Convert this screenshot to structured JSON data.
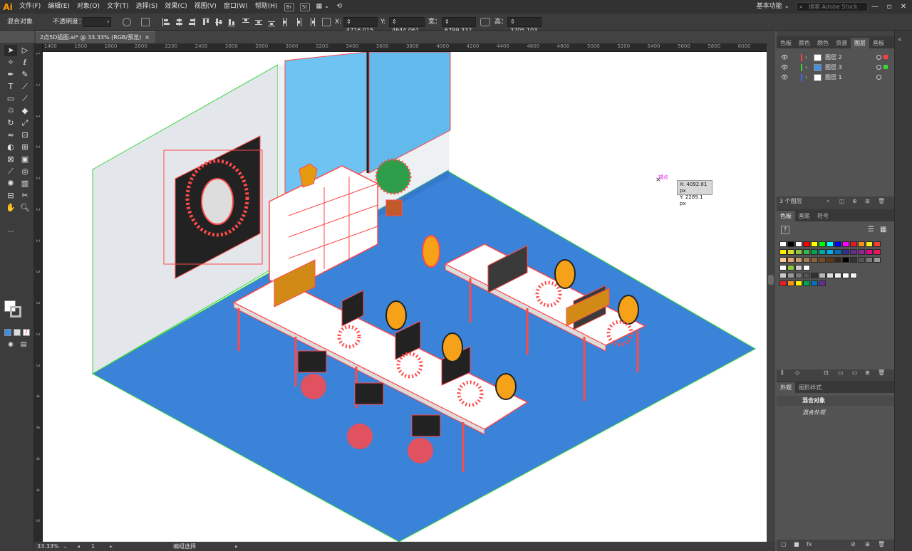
{
  "app": {
    "logo": "Ai"
  },
  "menubar": {
    "items": [
      "文件(F)",
      "编辑(E)",
      "对象(O)",
      "文字(T)",
      "选择(S)",
      "效果(C)",
      "视图(V)",
      "窗口(W)",
      "帮助(H)"
    ],
    "bridge_label": "Br",
    "stock_label": "St",
    "workspace": "基本功能 ⌄",
    "search_placeholder": "搜索 Adobe Stock"
  },
  "controlbar": {
    "selection_label": "混合对象",
    "opacity_label": "不透明度：",
    "x_label": "X:",
    "x_value": "4716.015",
    "y_label": "Y:",
    "y_value": "4644.061",
    "w_label": "宽：",
    "w_value": "6799.332",
    "h_label": "高：",
    "h_value": "3705.103"
  },
  "document": {
    "tab_title": "2点5D插图.ai* @ 33.33% (RGB/预览)",
    "tab_close": "×"
  },
  "rulers": {
    "h_ticks": [
      "1400",
      "1600",
      "1800",
      "2000",
      "2200",
      "2400",
      "2600",
      "2800",
      "3000",
      "3200",
      "3400",
      "3600",
      "3800",
      "4000",
      "4200",
      "4400",
      "4600",
      "4800",
      "5000",
      "5200",
      "5400",
      "5600",
      "5800",
      "6000"
    ],
    "v_ticks": [
      "1",
      "1",
      "1",
      "2",
      "2",
      "2",
      "2",
      "3",
      "3",
      "3",
      "3",
      "4",
      "4",
      "4",
      "4",
      "5"
    ]
  },
  "canvas": {
    "smart_guide_label": "锚点",
    "tooltip_x": "X: 4092.01 px",
    "tooltip_y": "Y: 2289.1 px",
    "colors": {
      "floor": "#3b82d9",
      "wall": "#dfe5ea",
      "window": "#6fc3f2",
      "selection": "#ff4a4a",
      "guide": "#37d63a"
    }
  },
  "statusbar": {
    "zoom": "33.33%",
    "artboard": "1",
    "tool": "编组选择"
  },
  "layers_panel": {
    "tabs": [
      "色板",
      "颜色",
      "颜色",
      "资源",
      "图层",
      "画板"
    ],
    "active_tab": "图层",
    "layers": [
      {
        "name": "图层 2",
        "color": "#ff4040"
      },
      {
        "name": "图层 3",
        "color": "#39d639"
      },
      {
        "name": "图层 1",
        "color": "#3d6bff"
      }
    ],
    "count_label": "3 个图层"
  },
  "swatches_panel": {
    "tabs": [
      "色板",
      "画笔",
      "符号"
    ],
    "active_tab": "色板"
  },
  "appearance_panel": {
    "tabs": [
      "外观",
      "图形样式"
    ],
    "active_tab": "外观",
    "object_label": "混合对象",
    "sub_label": "混合外观"
  }
}
